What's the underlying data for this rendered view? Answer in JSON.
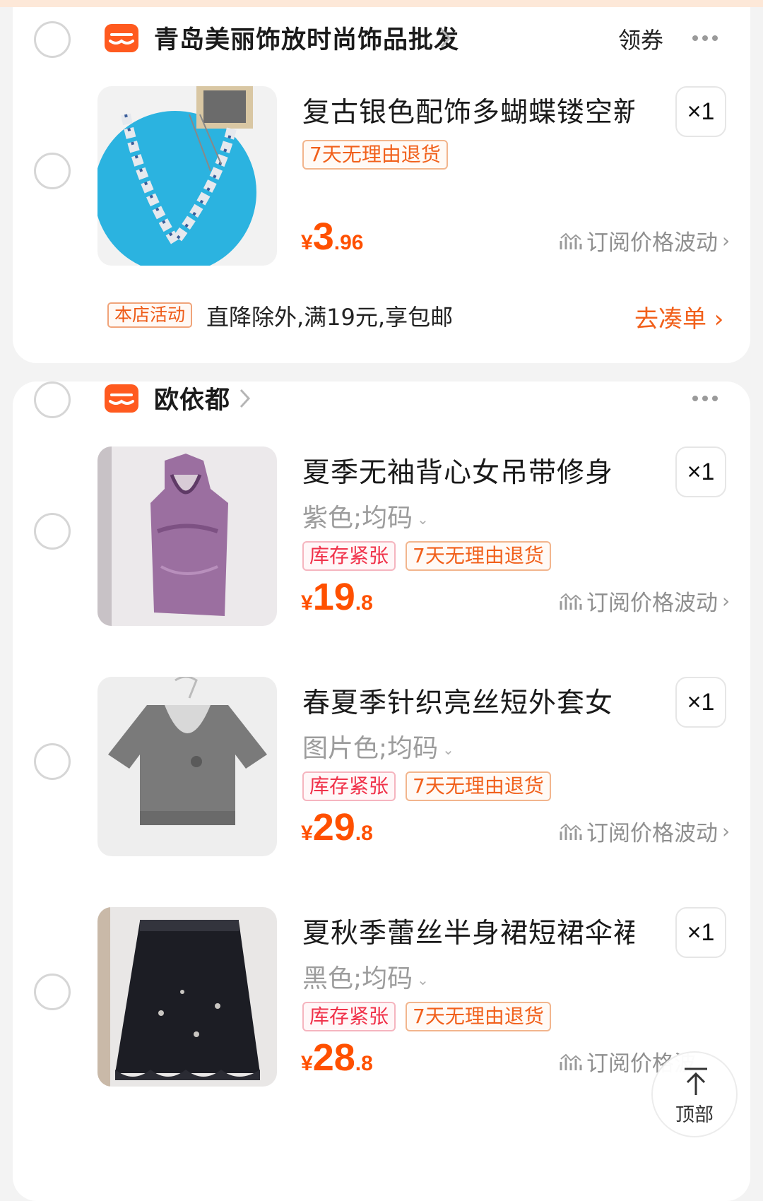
{
  "shops": [
    {
      "name": "青岛美丽饰放时尚饰品批发",
      "coupon_label": "领券",
      "items": [
        {
          "title": "复古银色配饰多蝴蝶镂空新",
          "quantity": "×1",
          "tags": [
            "7天无理由退货"
          ],
          "price": {
            "currency": "¥",
            "integer": "3",
            "decimal": ".96"
          },
          "subscribe_label": "订阅价格波动"
        }
      ],
      "promo": {
        "tag": "本店活动",
        "text": "直降除外,满19元,享包邮",
        "action": "去凑单"
      }
    },
    {
      "name": "欧依都",
      "items": [
        {
          "title": "夏季无袖背心女吊带修身",
          "quantity": "×1",
          "sku": "紫色;均码",
          "tags": [
            "库存紧张",
            "7天无理由退货"
          ],
          "price": {
            "currency": "¥",
            "integer": "19",
            "decimal": ".8"
          },
          "subscribe_label": "订阅价格波动"
        },
        {
          "title": "春夏季针织亮丝短外套女",
          "quantity": "×1",
          "sku": "图片色;均码",
          "tags": [
            "库存紧张",
            "7天无理由退货"
          ],
          "price": {
            "currency": "¥",
            "integer": "29",
            "decimal": ".8"
          },
          "subscribe_label": "订阅价格波动"
        },
        {
          "title": "夏秋季蕾丝半身裙短裙伞裙",
          "quantity": "×1",
          "sku": "黑色;均码",
          "tags": [
            "库存紧张",
            "7天无理由退货"
          ],
          "price": {
            "currency": "¥",
            "integer": "28",
            "decimal": ".8"
          },
          "subscribe_label": "订阅价格波"
        }
      ]
    }
  ],
  "back_to_top_label": "顶部",
  "colors": {
    "accent_orange": "#ff5000",
    "tag_red": "#f0324a",
    "shop_icon": "#ff5a1f"
  },
  "icons": {
    "shop": "shop-icon",
    "more": "more-dots-icon",
    "subscribe": "price-trend-icon",
    "back_to_top": "arrow-up-icon"
  }
}
